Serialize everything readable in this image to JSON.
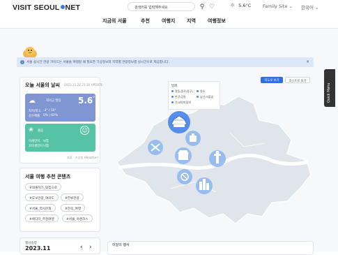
{
  "header": {
    "logo": {
      "text_left": "VISIT SEOUL",
      "text_right": "NET"
    },
    "search_placeholder": "검색어를 입력해주세요",
    "weather_temp": "5.6°C",
    "family_site": "Family Site",
    "language": "한국어",
    "nav": [
      "지금의 서울",
      "추천",
      "여행지",
      "지역",
      "여행정보"
    ]
  },
  "notice": {
    "text": "서울 실시간 관광 가이드는 서울을 여행할 때 필요한 기상정보와 지역별 관광정보를 실시간으로 제공합니다.",
    "close": "×",
    "info": "i"
  },
  "weather_card": {
    "title": "오늘 서울의 날씨",
    "updated": "2023.11.27 21:30 UPDATE",
    "blue": {
      "label": "최저군 맑음",
      "temp": "5.6",
      "unit": "°",
      "line1": "최저/최고",
      "line1_val": "-3° / 10°",
      "line2": "강수확률",
      "line2_val": "0% | 60%"
    },
    "green": {
      "label": "좋음",
      "line1": "미세먼지",
      "line1_val": "보통",
      "line2": "초미세먼지",
      "line2_val": "나쁨"
    },
    "source": "자료 : 기상청 (Weather)"
  },
  "recommend_card": {
    "title": "서울 여행 추천 콘텐츠",
    "tags": [
      "#외출하기_맛집으로",
      "#도보관광_여의도",
      "#한류관광",
      "#서울_역사문화",
      "#한옥_여행",
      "#에디터_추천여행",
      "#서울_야경코스"
    ]
  },
  "calendar": {
    "label": "행사일정",
    "month": "2023.11",
    "prev": "‹",
    "next": "›"
  },
  "map": {
    "btn_map": "지도로 보기",
    "btn_list": "리스트로 보기",
    "legend": {
      "title": "범례",
      "items": [
        "명동(종로/중구)",
        "명소",
        "한강/공원",
        "남산/서울숲",
        "전시회/박람회"
      ]
    },
    "colors": {
      "accent": "#4a86e8",
      "bubble": "#7fb3f0",
      "land": "#dfe5ee"
    }
  },
  "event_panel": {
    "title": "이달의 행사"
  },
  "quick_menu": "Quick Menu"
}
